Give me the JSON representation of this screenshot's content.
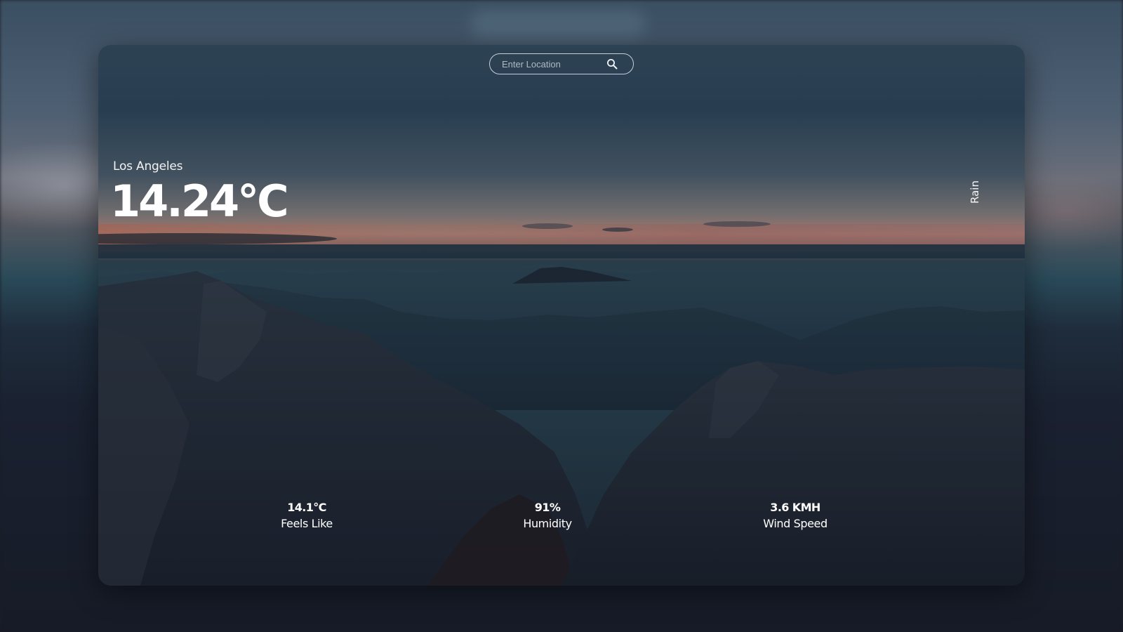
{
  "search": {
    "placeholder": "Enter Location",
    "value": ""
  },
  "weather": {
    "location": "Los Angeles",
    "temperature": "14.24°C",
    "condition": "Rain"
  },
  "stats": [
    {
      "value": "14.1°C",
      "label": "Feels Like"
    },
    {
      "value": "91%",
      "label": "Humidity"
    },
    {
      "value": "3.6 KMH",
      "label": "Wind Speed"
    }
  ],
  "icons": {
    "search": "search-icon"
  },
  "colors": {
    "text": "#ffffff",
    "search_border": "#e1e8f0"
  }
}
